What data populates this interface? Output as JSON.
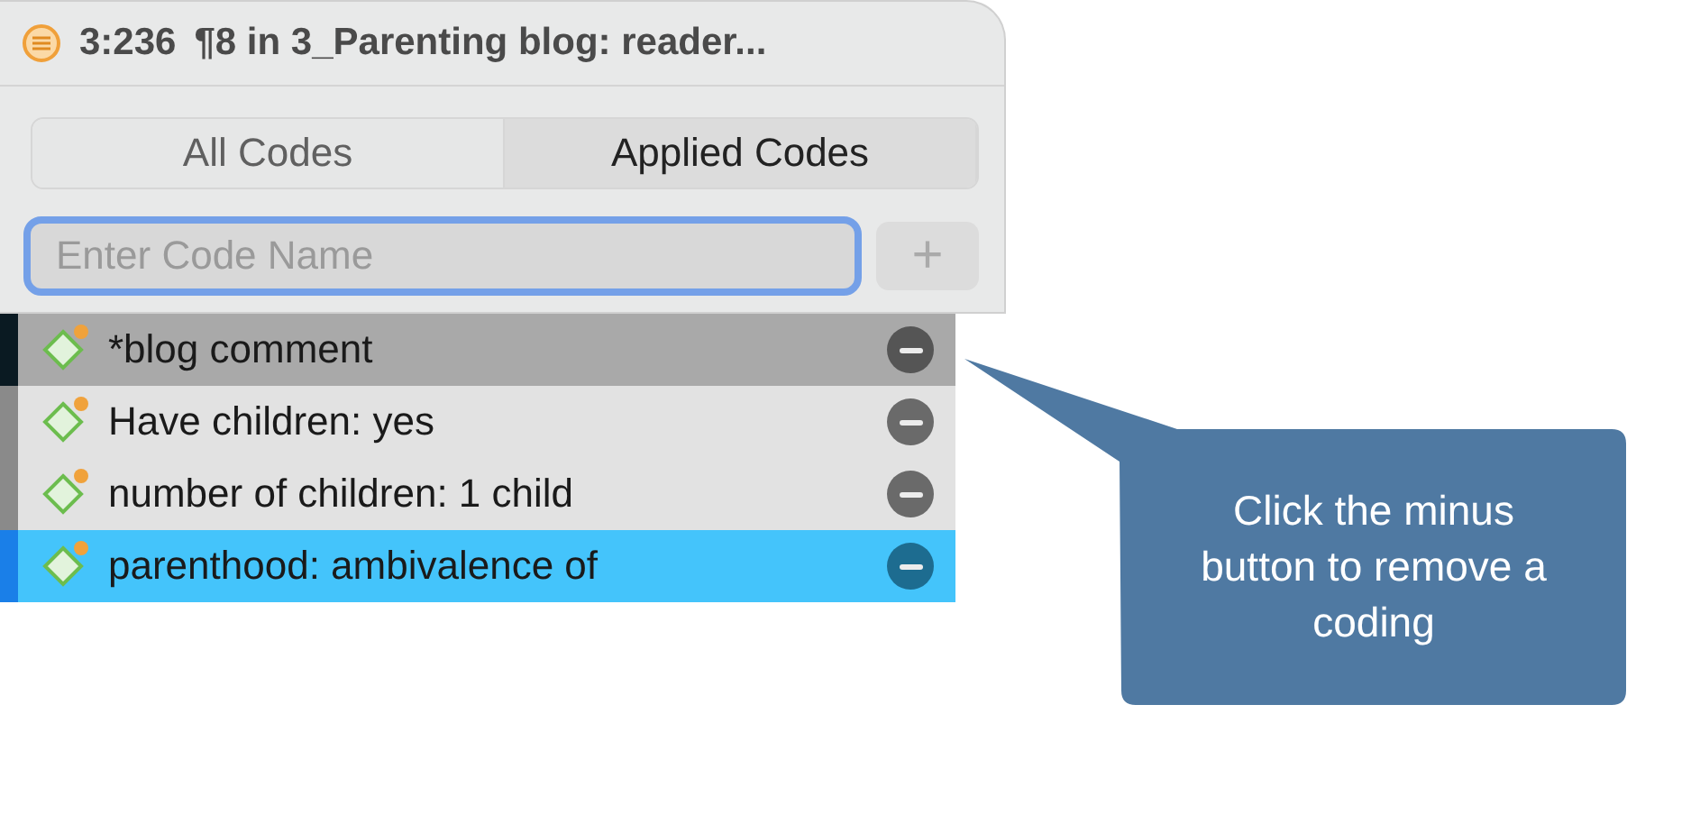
{
  "window": {
    "title_id": "3:236",
    "title": "¶8 in 3_Parenting blog: reader..."
  },
  "tabs": [
    {
      "label": "All Codes",
      "selected": false
    },
    {
      "label": "Applied Codes",
      "selected": true
    }
  ],
  "search": {
    "placeholder": "Enter Code Name",
    "focused": true
  },
  "add_button": {
    "label": "+",
    "disabled": true
  },
  "codes": [
    {
      "name": "*blog comment",
      "highlighted": true,
      "selected": false,
      "color": "#0a1a22"
    },
    {
      "name": "Have children: yes",
      "highlighted": false,
      "selected": false,
      "color": "#8a8a8a"
    },
    {
      "name": "number of children: 1 child",
      "highlighted": false,
      "selected": false,
      "color": "#8a8a8a"
    },
    {
      "name": "parenthood: ambivalence of",
      "highlighted": false,
      "selected": true,
      "color": "#1a7fe8"
    }
  ],
  "callout": {
    "text": "Click the minus button to remove a coding"
  }
}
